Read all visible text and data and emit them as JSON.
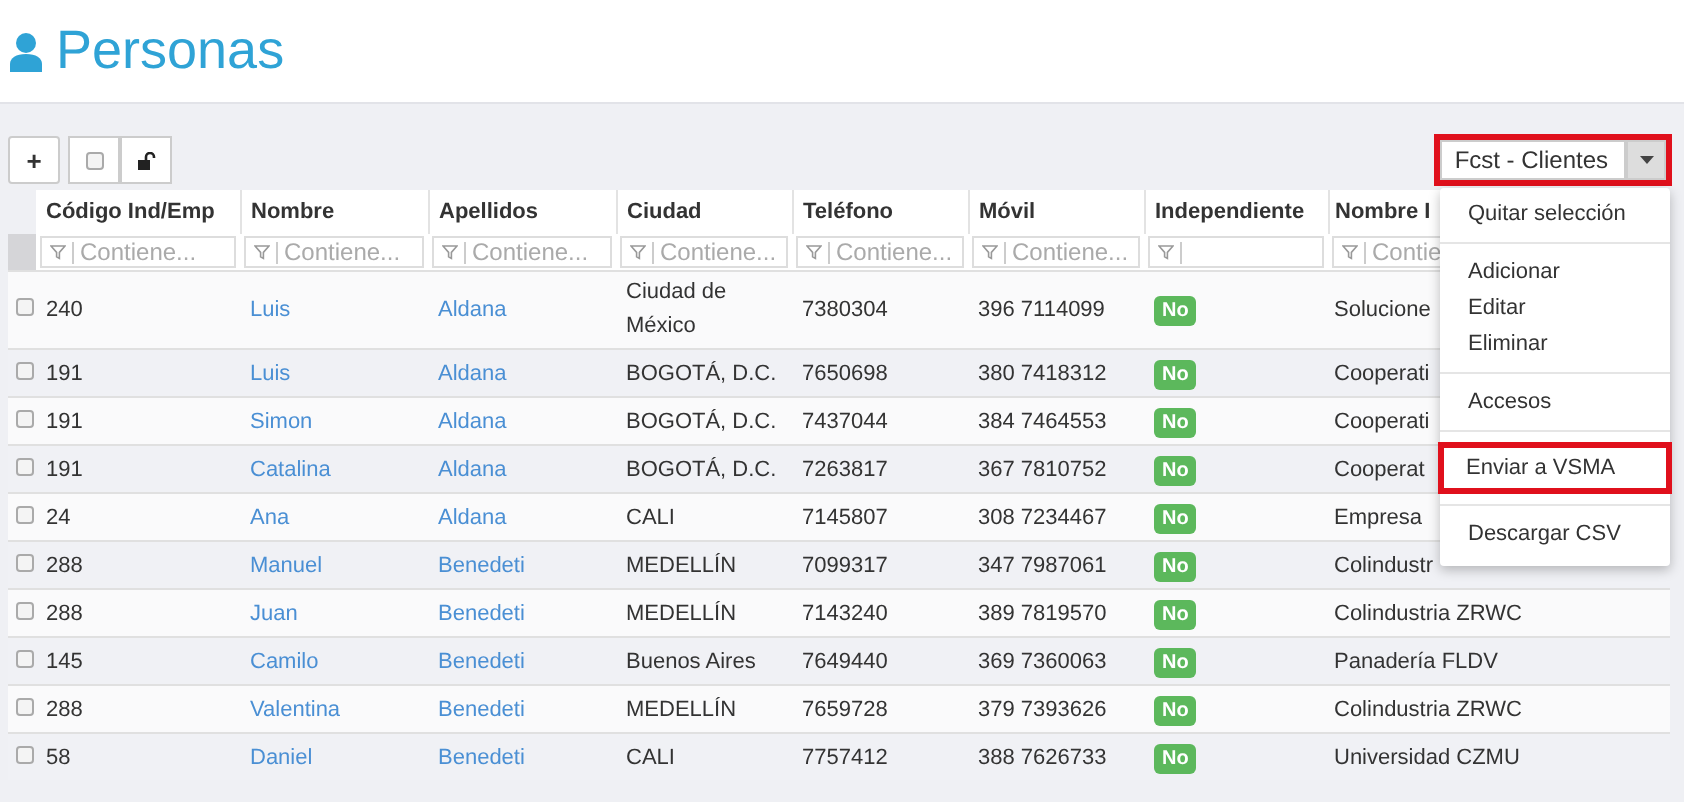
{
  "page_title": "Personas",
  "toolbar": {
    "buttons": [
      {
        "kind": "add",
        "label": "+"
      },
      {
        "kind": "checkbox",
        "checked": false
      },
      {
        "kind": "lock"
      }
    ]
  },
  "view_select": {
    "value": "Fcst - Clientes",
    "highlighted": true
  },
  "table": {
    "columns": [
      "Código Ind/Emp",
      "Nombre",
      "Apellidos",
      "Ciudad",
      "Teléfono",
      "Móvil",
      "Independiente",
      "Nombre I"
    ],
    "filters": [
      {
        "kind": "text",
        "placeholder": "Contiene..."
      },
      {
        "kind": "text",
        "placeholder": "Contiene..."
      },
      {
        "kind": "text",
        "placeholder": "Contiene..."
      },
      {
        "kind": "text",
        "placeholder": "Contiene..."
      },
      {
        "kind": "text",
        "placeholder": "Contiene..."
      },
      {
        "kind": "text",
        "placeholder": "Contiene..."
      },
      {
        "kind": "boolean"
      },
      {
        "kind": "text",
        "placeholder": "Contie"
      }
    ],
    "rows": [
      {
        "checked": false,
        "code": "240",
        "name": "Luis",
        "surname": "Aldana",
        "city": "Ciudad de México",
        "phone": "7380304",
        "mobile": "396 7114099",
        "independent": "No",
        "company": "Solucione"
      },
      {
        "checked": false,
        "code": "191",
        "name": "Luis",
        "surname": "Aldana",
        "city": "BOGOTÁ, D.C.",
        "phone": "7650698",
        "mobile": "380 7418312",
        "independent": "No",
        "company": "Cooperati"
      },
      {
        "checked": false,
        "code": "191",
        "name": "Simon",
        "surname": "Aldana",
        "city": "BOGOTÁ, D.C.",
        "phone": "7437044",
        "mobile": "384 7464553",
        "independent": "No",
        "company": "Cooperati"
      },
      {
        "checked": false,
        "code": "191",
        "name": "Catalina",
        "surname": "Aldana",
        "city": "BOGOTÁ, D.C.",
        "phone": "7263817",
        "mobile": "367 7810752",
        "independent": "No",
        "company": "Cooperat"
      },
      {
        "checked": false,
        "code": "24",
        "name": "Ana",
        "surname": "Aldana",
        "city": "CALI",
        "phone": "7145807",
        "mobile": "308 7234467",
        "independent": "No",
        "company": "Empresa"
      },
      {
        "checked": false,
        "code": "288",
        "name": "Manuel",
        "surname": "Benedeti",
        "city": "MEDELLÍN",
        "phone": "7099317",
        "mobile": "347 7987061",
        "independent": "No",
        "company": "Colindustr"
      },
      {
        "checked": false,
        "code": "288",
        "name": "Juan",
        "surname": "Benedeti",
        "city": "MEDELLÍN",
        "phone": "7143240",
        "mobile": "389 7819570",
        "independent": "No",
        "company": "Colindustria ZRWC"
      },
      {
        "checked": false,
        "code": "145",
        "name": "Camilo",
        "surname": "Benedeti",
        "city": "Buenos Aires",
        "phone": "7649440",
        "mobile": "369 7360063",
        "independent": "No",
        "company": "Panadería FLDV"
      },
      {
        "checked": false,
        "code": "288",
        "name": "Valentina",
        "surname": "Benedeti",
        "city": "MEDELLÍN",
        "phone": "7659728",
        "mobile": "379 7393626",
        "independent": "No",
        "company": "Colindustria ZRWC"
      },
      {
        "checked": false,
        "code": "58",
        "name": "Daniel",
        "surname": "Benedeti",
        "city": "CALI",
        "phone": "7757412",
        "mobile": "388 7626733",
        "independent": "No",
        "company": "Universidad CZMU"
      }
    ]
  },
  "menu": {
    "groups": [
      [
        {
          "label": "Quitar selección",
          "highlighted": false
        }
      ],
      [
        {
          "label": "Adicionar",
          "highlighted": false
        },
        {
          "label": "Editar",
          "highlighted": false
        },
        {
          "label": "Eliminar",
          "highlighted": false
        }
      ],
      [
        {
          "label": "Accesos",
          "highlighted": false
        }
      ],
      [
        {
          "label": "Enviar a VSMA",
          "highlighted": true
        }
      ],
      [
        {
          "label": "Descargar CSV",
          "highlighted": false
        }
      ]
    ]
  }
}
